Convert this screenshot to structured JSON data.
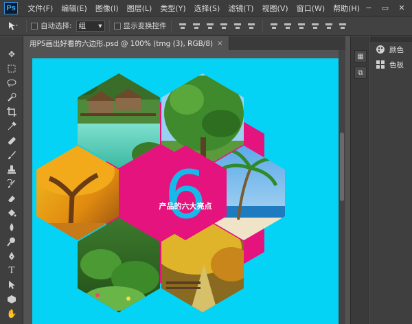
{
  "app": {
    "logo": "Ps",
    "menu": [
      "文件(F)",
      "编辑(E)",
      "图像(I)",
      "图层(L)",
      "类型(Y)",
      "选择(S)",
      "滤镜(T)",
      "视图(V)",
      "窗口(W)",
      "帮助(H)"
    ],
    "window_controls": {
      "minimize": "−",
      "maximize": "▭",
      "close": "✕"
    }
  },
  "options_bar": {
    "auto_select_label": "自动选择:",
    "auto_select_value": "组",
    "show_transform_label": "显示变换控件"
  },
  "document": {
    "tab_title": "用PS画出好看的六边形.psd @ 100% (tmg (3), RGB/8)",
    "tab_close": "×",
    "center_number": "6",
    "center_caption": "产品的六大亮点",
    "colors": {
      "canvas_bg": "#05d3f6",
      "hex_pink": "#e5137e",
      "number_blue": "#17b8ea"
    }
  },
  "panels": {
    "items": [
      {
        "label": "颜色",
        "icon": "palette-icon"
      },
      {
        "label": "色板",
        "icon": "swatches-icon"
      }
    ]
  },
  "toolbar": {
    "tools": [
      "move-tool-icon",
      "marquee-tool-icon",
      "lasso-tool-icon",
      "quick-select-tool-icon",
      "crop-tool-icon",
      "eyedropper-tool-icon",
      "healing-brush-tool-icon",
      "brush-tool-icon",
      "clone-stamp-tool-icon",
      "history-brush-tool-icon",
      "eraser-tool-icon",
      "paint-bucket-tool-icon",
      "blur-tool-icon",
      "dodge-tool-icon",
      "pen-tool-icon",
      "type-tool-icon",
      "path-select-tool-icon",
      "shape-tool-icon",
      "hand-tool-icon",
      "zoom-tool-icon"
    ]
  }
}
